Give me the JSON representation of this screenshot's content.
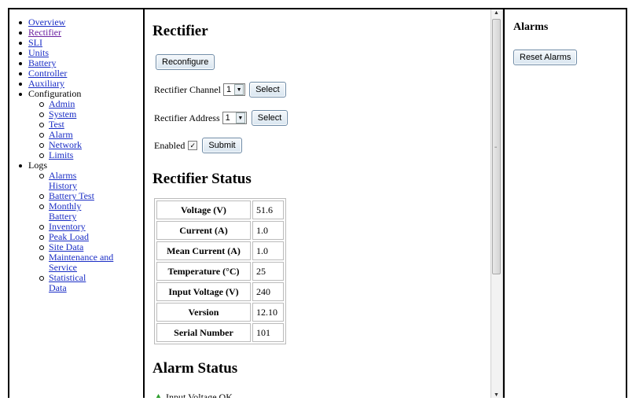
{
  "sidebar": {
    "items": [
      {
        "label": "Overview",
        "link": true
      },
      {
        "label": "Rectifier",
        "link": true,
        "visited": true
      },
      {
        "label": "SLI",
        "link": true
      },
      {
        "label": "Units",
        "link": true
      },
      {
        "label": "Battery",
        "link": true
      },
      {
        "label": "Controller",
        "link": true
      },
      {
        "label": "Auxiliary",
        "link": true
      },
      {
        "label": "Configuration",
        "link": false
      },
      {
        "label": "Logs",
        "link": false
      }
    ],
    "configuration_sub": [
      "Admin",
      "System",
      "Test",
      "Alarm",
      "Network",
      "Limits"
    ],
    "logs_sub": [
      "Alarms History",
      "Battery Test",
      "Monthly Battery",
      "Inventory",
      "Peak Load",
      "Site Data",
      "Maintenance and Service",
      "Statistical Data"
    ]
  },
  "main": {
    "title": "Rectifier",
    "reconfigure_label": "Reconfigure",
    "channel_label": "Rectifier Channel",
    "channel_value": "1",
    "address_label": "Rectifier Address",
    "address_value": "1",
    "select_label": "Select",
    "enabled_label": "Enabled",
    "enabled_checked": true,
    "submit_label": "Submit",
    "status_title": "Rectifier Status",
    "status_rows": [
      {
        "key": "Voltage (V)",
        "value": "51.6"
      },
      {
        "key": "Current (A)",
        "value": "1.0"
      },
      {
        "key": "Mean Current (A)",
        "value": "1.0"
      },
      {
        "key": "Temperature (°C)",
        "value": "25"
      },
      {
        "key": "Input Voltage (V)",
        "value": "240"
      },
      {
        "key": "Version",
        "value": "12.10"
      },
      {
        "key": "Serial Number",
        "value": "101"
      }
    ],
    "alarm_title": "Alarm Status",
    "alarm_item": "Input Voltage OK",
    "alarm_ok_color": "#2e9e2e"
  },
  "right": {
    "title": "Alarms",
    "reset_label": "Reset Alarms"
  },
  "colors": {
    "link": "#1a2dc5",
    "visited": "#6a1fa0",
    "button_border": "#6d8aa6"
  }
}
